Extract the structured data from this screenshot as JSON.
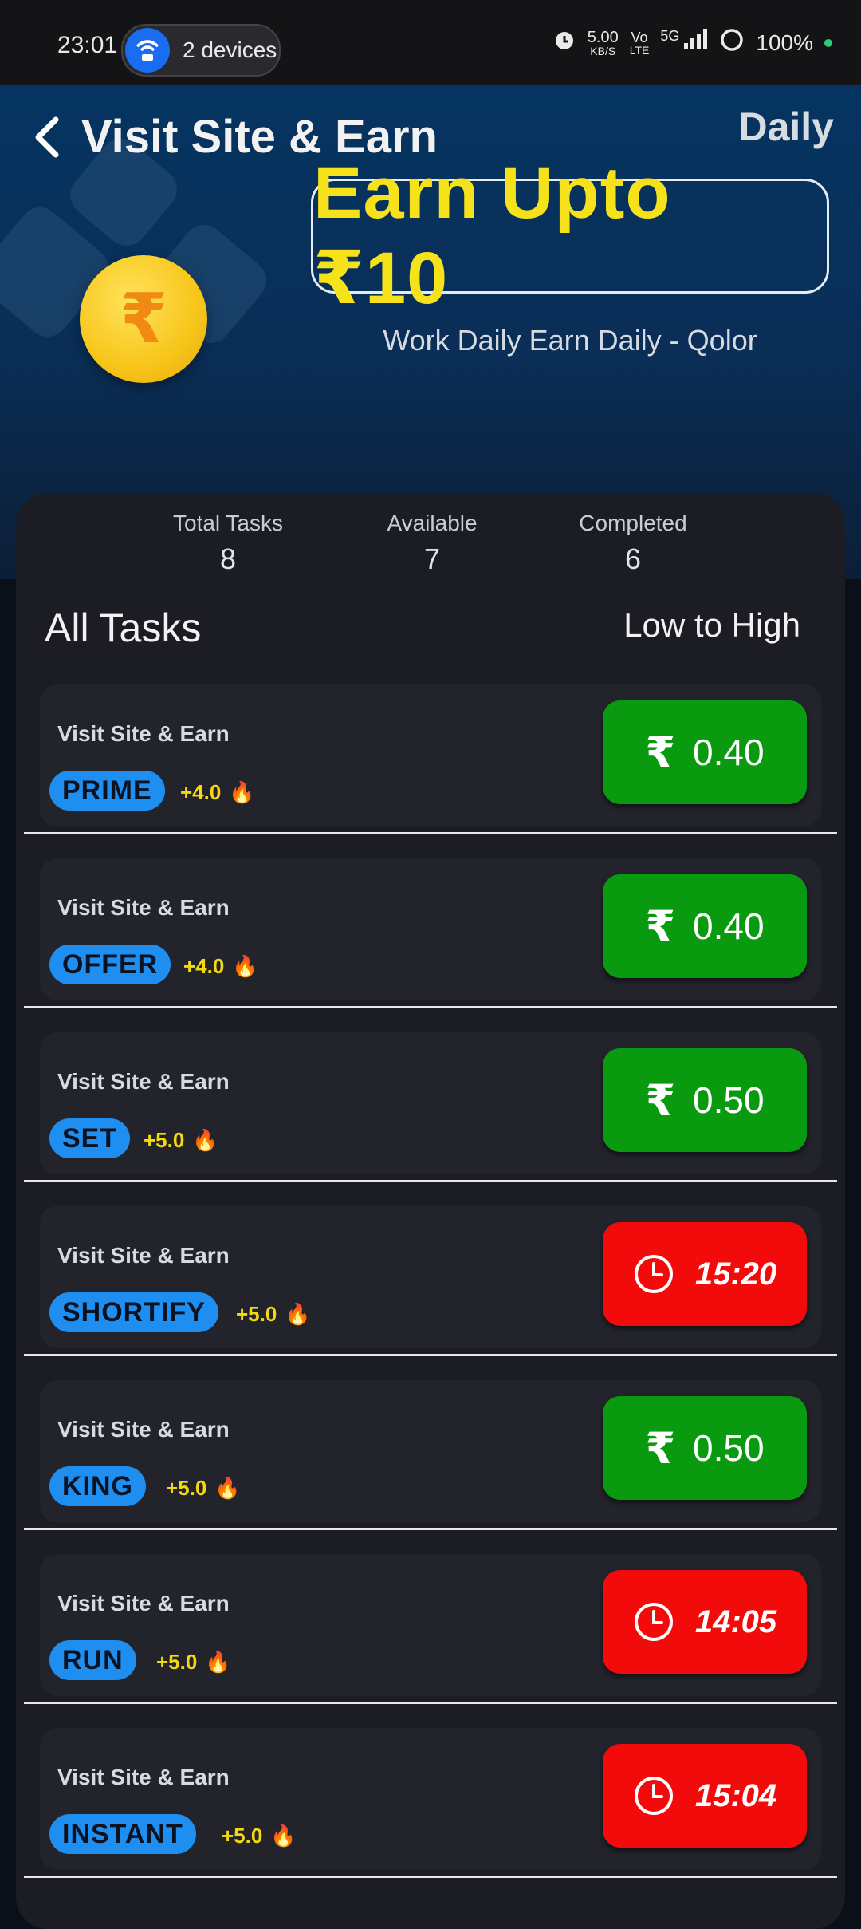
{
  "status_bar": {
    "time": "23:01",
    "hotspot_label": "2 devices",
    "net_speed": "5.00",
    "net_unit": "KB/S",
    "volte": "Vo",
    "lte": "LTE",
    "network": "5G",
    "battery": "100%"
  },
  "header": {
    "title": "Visit Site & Earn",
    "period": "Daily",
    "banner": "Earn Upto ₹10",
    "tagline": "Work Daily Earn Daily - Qolor",
    "coin_symbol": "₹"
  },
  "stats": [
    {
      "label": "Total Tasks",
      "value": "8"
    },
    {
      "label": "Available",
      "value": "7"
    },
    {
      "label": "Completed",
      "value": "6"
    }
  ],
  "list": {
    "heading": "All Tasks",
    "sort": "Low to High"
  },
  "tasks": [
    {
      "name": "Visit Site & Earn",
      "tag": "PRIME",
      "bonus": "+4.0",
      "action": "₹ 0.40",
      "currency": "₹",
      "amount": "0.40",
      "state": "available"
    },
    {
      "name": "Visit Site & Earn",
      "tag": "OFFER",
      "bonus": "+4.0",
      "action": "₹ 0.40",
      "currency": "₹",
      "amount": "0.40",
      "state": "available"
    },
    {
      "name": "Visit Site & Earn",
      "tag": "SET",
      "bonus": "+5.0",
      "action": "₹ 0.50",
      "currency": "₹",
      "amount": "0.50",
      "state": "available"
    },
    {
      "name": "Visit Site & Earn",
      "tag": "SHORTIFY",
      "bonus": "+5.0",
      "action": "15:20",
      "timer": "15:20",
      "state": "cooldown"
    },
    {
      "name": "Visit Site & Earn",
      "tag": "KING",
      "bonus": "+5.0",
      "action": "₹ 0.50",
      "currency": "₹",
      "amount": "0.50",
      "state": "available"
    },
    {
      "name": "Visit Site & Earn",
      "tag": "RUN",
      "bonus": "+5.0",
      "action": "14:05",
      "timer": "14:05",
      "state": "cooldown"
    },
    {
      "name": "Visit Site & Earn",
      "tag": "INSTANT",
      "bonus": "+5.0",
      "action": "15:04",
      "timer": "15:04",
      "state": "cooldown"
    }
  ],
  "colors": {
    "available": "#0a9a10",
    "cooldown": "#f30a0a",
    "badge": "#1f8ef1",
    "bonus": "#f5d90f",
    "banner_text": "#f6e21b"
  }
}
